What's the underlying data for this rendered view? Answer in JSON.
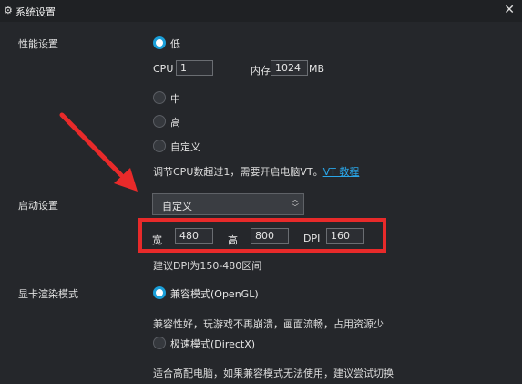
{
  "window": {
    "title": "系统设置",
    "close_glyph": "✕",
    "gear_glyph": "⚙"
  },
  "performance": {
    "section_label": "性能设置",
    "options": [
      {
        "label": "低",
        "checked": true
      },
      {
        "label": "中",
        "checked": false
      },
      {
        "label": "高",
        "checked": false
      },
      {
        "label": "自定义",
        "checked": false
      }
    ],
    "cpu_label": "CPU",
    "cpu_value": "1",
    "mem_label": "内存",
    "mem_value": "1024",
    "mem_unit": "MB",
    "hint_text": "调节CPU数超过1，需要开启电脑VT。",
    "hint_link": "VT 教程"
  },
  "startup": {
    "section_label": "启动设置",
    "select_value": "自定义",
    "width_label": "宽",
    "width_value": "480",
    "height_label": "高",
    "height_value": "800",
    "dpi_label": "DPI",
    "dpi_value": "160",
    "dpi_hint": "建议DPI为150-480区间"
  },
  "render": {
    "section_label": "显卡渲染模式",
    "options": [
      {
        "label": "兼容模式(OpenGL)",
        "checked": true,
        "desc": "兼容性好，玩游戏不再崩溃，画面流畅，占用资源少"
      },
      {
        "label": "极速模式(DirectX)",
        "checked": false,
        "desc": "适合高配电脑，如果兼容模式无法使用，建议尝试切换"
      }
    ]
  },
  "colors": {
    "accent": "#1a9fd9",
    "highlight": "#e82a2a",
    "background": "#25272b"
  },
  "icons": {
    "gear": "gear-icon",
    "close": "close-icon",
    "arrow": "red-annotation-arrow"
  }
}
